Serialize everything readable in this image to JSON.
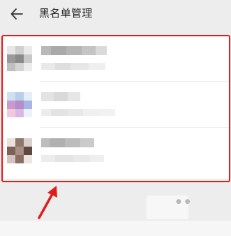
{
  "header": {
    "title": "黑名单管理",
    "back_icon": "arrow-left-icon"
  },
  "colors": {
    "background": "#ededed",
    "list_background": "#ffffff",
    "highlight_border": "#e21b1b",
    "annotation_arrow": "#e21b1b"
  },
  "blacklist": {
    "rows": [
      {
        "avatar_pixels": [
          "#e6e6e6",
          "#cfcfcf",
          "#eaeaea",
          "#9a9a9a",
          "#8a8a8a",
          "#c8c8c8",
          "#bfbfbf",
          "#d4d4d4",
          "#ececec"
        ],
        "name_pixels": [
          "#b8b8b8",
          "#a9a9a9",
          "#b5b5b5",
          "#c4c4c4",
          "#dadada"
        ],
        "meta_pixels": [
          "#e9e9e9",
          "#dedede",
          "#e6e6e6",
          "#efefef"
        ]
      },
      {
        "avatar_pixels": [
          "#cfe0f2",
          "#b9cfe9",
          "#e3eef8",
          "#c89ad0",
          "#b58dc9",
          "#a7b6e6",
          "#f0c9dc",
          "#d7b8e3",
          "#eef1fa"
        ],
        "name_pixels": [
          "#e3e3e3",
          "#d9d9d9",
          "#e6e6e6"
        ],
        "meta_pixels": [
          "#ececec",
          "#e3e3e3",
          "#e8e8e8",
          "#f0f0f0",
          "#f2f2f2"
        ]
      },
      {
        "avatar_pixels": [
          "#e9e1dc",
          "#8f776b",
          "#dad0cb",
          "#7d6257",
          "#a98f83",
          "#5e4a43",
          "#d2c3bc",
          "#8c6f64",
          "#ece6e3"
        ],
        "name_pixels": [
          "#bdbdbd",
          "#b0b0b0",
          "#bcbcbc",
          "#cacaca"
        ],
        "meta_pixels": [
          "#ececec",
          "#e4e4e4",
          "#e9e9e9",
          "#efefef"
        ]
      }
    ]
  }
}
